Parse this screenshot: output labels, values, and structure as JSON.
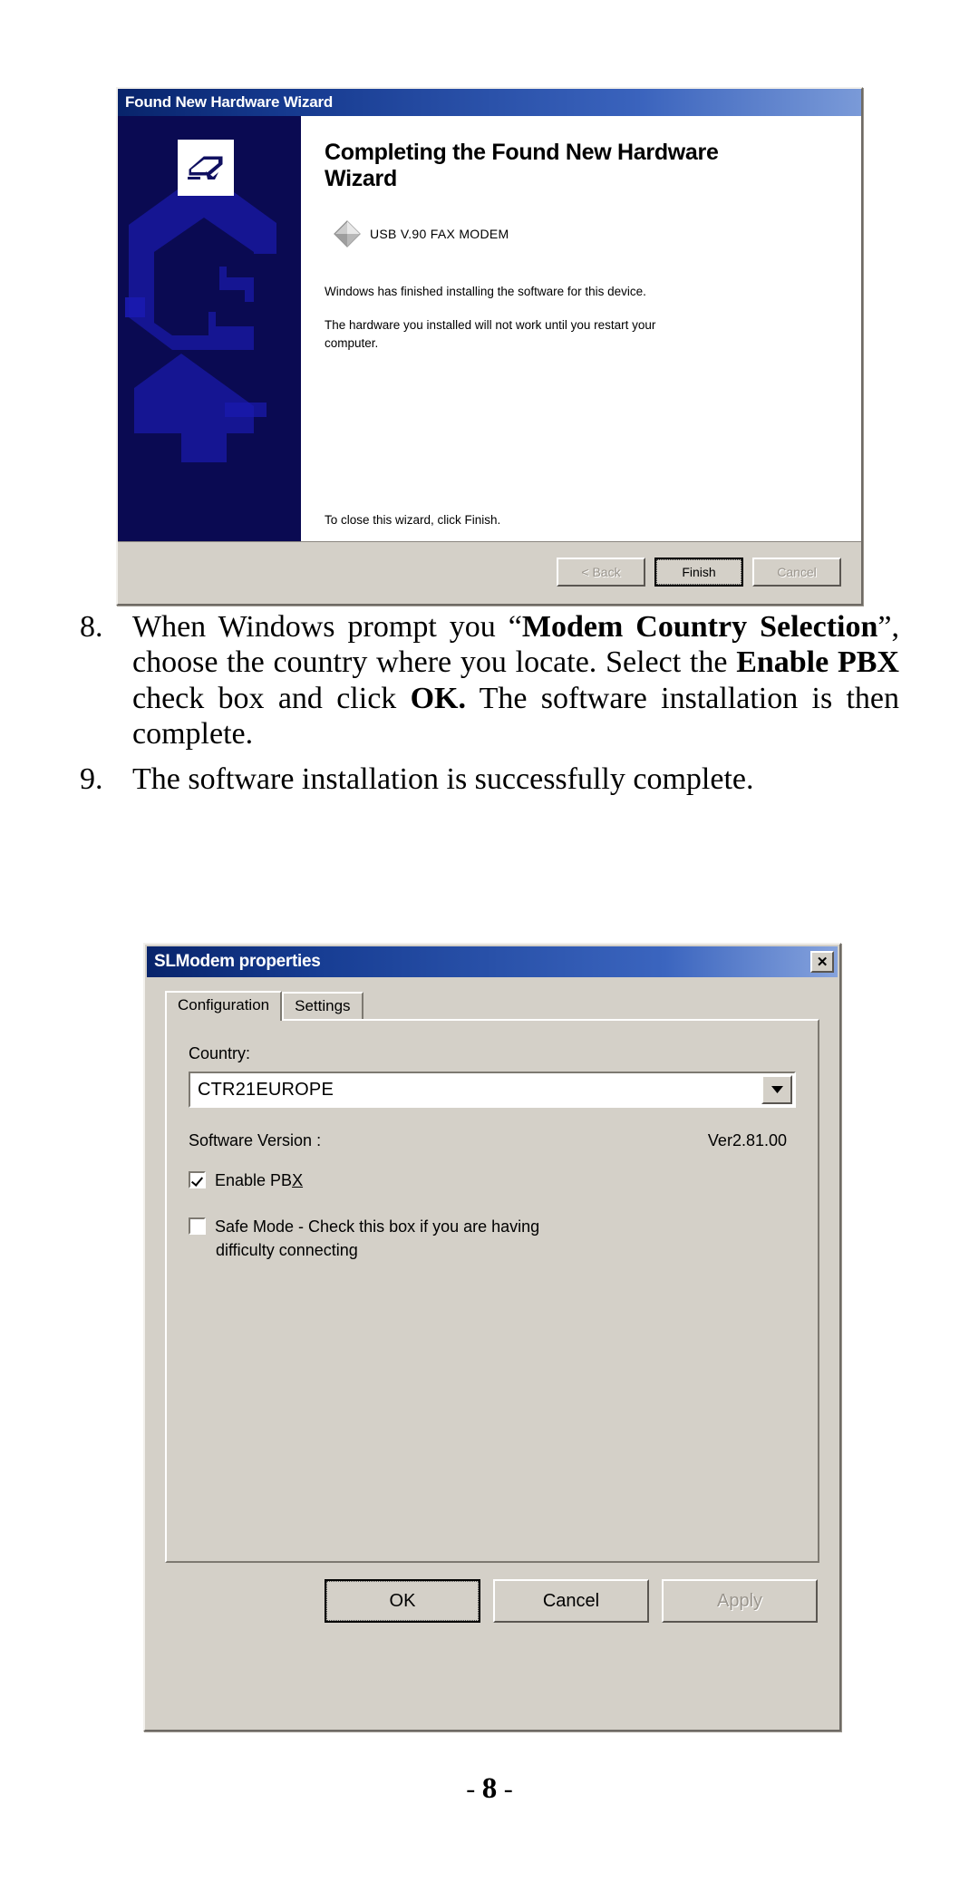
{
  "wizard": {
    "title": "Found New Hardware Wizard",
    "heading": "Completing the Found New Hardware Wizard",
    "device_name": "USB V.90 FAX MODEM",
    "paragraph_1": "Windows has finished installing the software for this device.",
    "paragraph_2": "The hardware you installed will not work until you restart your computer.",
    "close_note": "To close this wizard, click Finish.",
    "buttons": {
      "back": "< Back",
      "finish": "Finish",
      "cancel": "Cancel"
    }
  },
  "prose": {
    "item8": {
      "number": "8.",
      "part1": "When Windows prompt you “",
      "bold1": "Modem Country Selection",
      "part2": "”, choose the country where you locate.  Select the ",
      "bold2": "Enable PBX",
      "part3": " check box and click ",
      "bold3": "OK.",
      "part4": " The software installation is then complete."
    },
    "item9": {
      "number": "9.",
      "text": "The software installation is successfully complete."
    }
  },
  "props": {
    "title": "SLModem properties",
    "close_label": "✕",
    "tabs": [
      {
        "label": "Configuration",
        "active": true
      },
      {
        "label": "Settings",
        "active": false
      }
    ],
    "country_label": "Country:",
    "country_value": "CTR21EUROPE",
    "version_label": "Software Version :",
    "version_value": "Ver2.81.00",
    "enable_pbx_label_pre": "Enable PB",
    "enable_pbx_label_accel": "X",
    "enable_pbx_checked": true,
    "safe_mode_label": "Safe Mode - Check this box if you are having",
    "safe_mode_label_line2": "difficulty connecting",
    "safe_mode_checked": false,
    "buttons": {
      "ok": "OK",
      "cancel": "Cancel",
      "apply": "Apply"
    }
  },
  "footer": {
    "dash_left": "-",
    "page_number": "8",
    "dash_right": "-"
  },
  "colors": {
    "titlebar_start": "#08246b",
    "titlebar_end": "#86a3dd",
    "dialog_face": "#d4d0c8",
    "banner": "#0a0a52",
    "disabled_text": "#9a958d"
  }
}
